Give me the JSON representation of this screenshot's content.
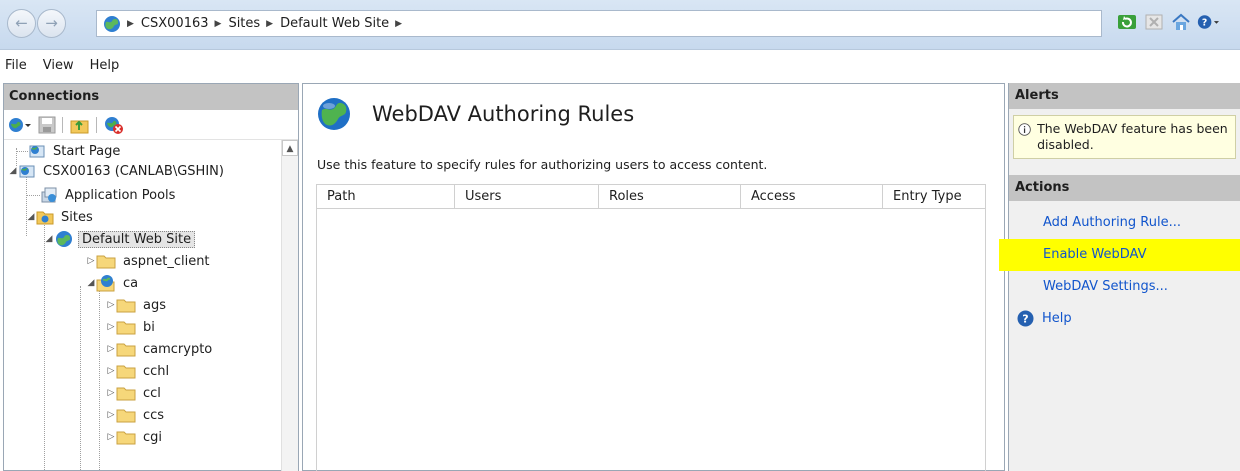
{
  "address_bar": {
    "crumbs": [
      "CSX00163",
      "Sites",
      "Default Web Site"
    ]
  },
  "menu": [
    "File",
    "View",
    "Help"
  ],
  "connections": {
    "title": "Connections",
    "tree": [
      {
        "label": "Start Page"
      },
      {
        "label": "CSX00163 (CANLAB\\GSHIN)"
      },
      {
        "label": "Application Pools"
      },
      {
        "label": "Sites"
      },
      {
        "label": "Default Web Site"
      },
      {
        "label": "aspnet_client"
      },
      {
        "label": "ca"
      },
      {
        "label": "ags"
      },
      {
        "label": "bi"
      },
      {
        "label": "camcrypto"
      },
      {
        "label": "cchl"
      },
      {
        "label": "ccl"
      },
      {
        "label": "ccs"
      },
      {
        "label": "cgi"
      }
    ]
  },
  "content": {
    "title": "WebDAV Authoring Rules",
    "description": "Use this feature to specify rules for authorizing users to access content.",
    "columns": [
      "Path",
      "Users",
      "Roles",
      "Access",
      "Entry Type"
    ]
  },
  "alerts": {
    "title": "Alerts",
    "message": "The WebDAV feature has been disabled."
  },
  "actions": {
    "title": "Actions",
    "items": [
      "Add Authoring Rule...",
      "Enable WebDAV",
      "WebDAV Settings..."
    ],
    "help_label": "Help",
    "highlight_color": "#ffff00"
  }
}
